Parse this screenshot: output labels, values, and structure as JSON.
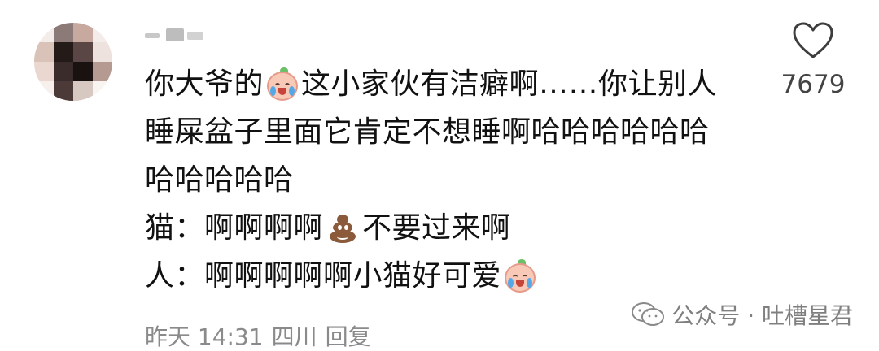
{
  "comment": {
    "username": "",
    "lines": [
      {
        "parts": [
          {
            "type": "text",
            "value": "你大爷的"
          },
          {
            "type": "emoji",
            "value": "cry"
          },
          {
            "type": "text",
            "value": "这小家伙有洁癖啊……你让别人"
          }
        ]
      },
      {
        "parts": [
          {
            "type": "text",
            "value": "睡屎盆子里面它肯定不想睡啊哈哈哈哈哈哈"
          }
        ]
      },
      {
        "parts": [
          {
            "type": "text",
            "value": "哈哈哈哈哈"
          }
        ]
      },
      {
        "parts": [
          {
            "type": "text",
            "value": "猫：啊啊啊啊"
          },
          {
            "type": "emoji",
            "value": "poop"
          },
          {
            "type": "text",
            "value": "不要过来啊"
          }
        ]
      },
      {
        "parts": [
          {
            "type": "text",
            "value": "人：啊啊啊啊啊小猫好可爱"
          },
          {
            "type": "emoji",
            "value": "cry"
          }
        ]
      }
    ],
    "meta": {
      "time": "昨天 14:31",
      "location": "四川",
      "reply_label": "回复"
    },
    "likes": "7679"
  },
  "watermark": {
    "text": "公众号 · 吐槽星君",
    "icon": "wechat-icon"
  },
  "colors": {
    "text": "#111111",
    "muted": "#8a8a8a",
    "like_count": "#444444"
  }
}
